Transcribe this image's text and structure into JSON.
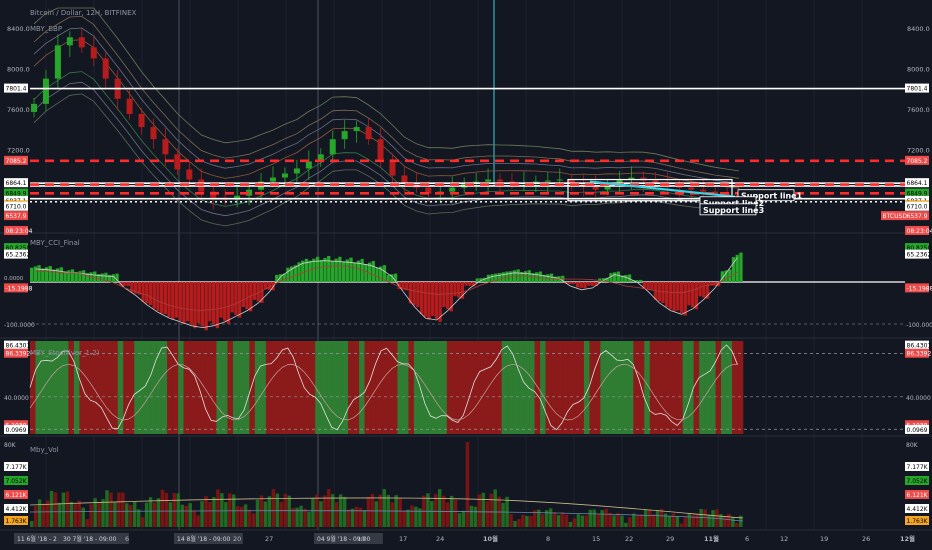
{
  "header": {
    "symbol_line": "Bitcoin / Dollar, 12H, BITFINEX",
    "indicator_label": "MBY_BBP"
  },
  "colors": {
    "background": "#131722",
    "bull": "#26a62a",
    "bear": "#b71c1c",
    "dash_red": "#ff2a2a",
    "cyan": "#3ad1e0",
    "white": "#ffffff"
  },
  "chart_data": [
    {
      "type": "line",
      "name": "price",
      "title": "Bitcoin / Dollar, 12H, BITFINEX",
      "y_ticks": [
        "8400.0",
        "8000.0",
        "7600.0",
        "7200.0"
      ],
      "ylim": [
        6400,
        8600
      ],
      "series_close_approx": [
        7650,
        7900,
        8230,
        8310,
        8210,
        8100,
        7900,
        7700,
        7550,
        7420,
        7300,
        7150,
        7000,
        6900,
        6780,
        6720,
        6700,
        6740,
        6800,
        6880,
        6920,
        6960,
        7010,
        7080,
        7150,
        7300,
        7380,
        7420,
        7300,
        7100,
        6940,
        6860,
        6820,
        6760,
        6780,
        6820,
        6860,
        6880,
        6900,
        6880,
        6860,
        6870,
        6880,
        6890,
        6900,
        6860,
        6830,
        6800,
        6840,
        6900,
        6920,
        6890,
        6860,
        6840,
        6820,
        6800,
        6780,
        6760,
        6745,
        6730
      ],
      "left_labels": [
        {
          "text": "7801.4",
          "kind": "white"
        },
        {
          "text": "7085.2",
          "kind": "red"
        },
        {
          "text": "6864.1",
          "kind": "white"
        },
        {
          "text": "6849.9",
          "kind": "green"
        },
        {
          "text": "6837.1",
          "kind": "white"
        },
        {
          "text": "6763.6",
          "kind": "orange"
        },
        {
          "text": "6710.0",
          "kind": "white"
        },
        {
          "text": "6537.9",
          "kind": "red"
        },
        {
          "text": "08:23:04",
          "kind": "red"
        }
      ],
      "right_labels": [
        {
          "text": "7801.4",
          "kind": "white"
        },
        {
          "text": "7085.2",
          "kind": "red"
        },
        {
          "text": "6864.1",
          "kind": "white"
        },
        {
          "text": "6849.9",
          "kind": "green"
        },
        {
          "text": "6837.1",
          "kind": "white"
        },
        {
          "text": "6763.6",
          "kind": "orange"
        },
        {
          "text": "6710.0",
          "kind": "white"
        },
        {
          "text": "6537.9",
          "kind": "red"
        },
        {
          "text": "BTCUSD",
          "kind": "red"
        },
        {
          "text": "08:23:04",
          "kind": "red"
        }
      ],
      "levels_solid": [
        7801.4,
        6864.1,
        6837.1,
        6710.0
      ],
      "levels_dashed_red": [
        7085.2,
        6849.9,
        6763.6
      ],
      "annotations": [
        "Support line1",
        "Support line2",
        "Support line3"
      ]
    },
    {
      "type": "bar",
      "name": "MBY_CCI_Final",
      "label": "MBY_CCI_Final",
      "left_ticks": [
        "80.8250",
        "65.2362",
        "-15.1988",
        "-100.0000"
      ],
      "right_ticks": [
        "80.8250",
        "65.2362",
        "-15.1988",
        "-100.0000"
      ],
      "zero_label": "0.0000",
      "values_approx": [
        40,
        38,
        35,
        30,
        28,
        25,
        22,
        20,
        -10,
        -30,
        -55,
        -75,
        -90,
        -100,
        -110,
        -115,
        -110,
        -100,
        -85,
        -70,
        -50,
        -20,
        20,
        40,
        55,
        60,
        62,
        60,
        58,
        55,
        50,
        40,
        20,
        -20,
        -60,
        -90,
        -95,
        -70,
        -40,
        -10,
        10,
        20,
        25,
        30,
        28,
        25,
        20,
        15,
        -5,
        -15,
        -10,
        10,
        25,
        18,
        5,
        -20,
        -50,
        -70,
        -80,
        -65,
        -40,
        -10,
        30,
        70
      ]
    },
    {
      "type": "line",
      "name": "MBY_Stoch",
      "label": "MBY_Stoch(ver_1.2)",
      "left_ticks": [
        "86.4301",
        "86.3392",
        "40.0000",
        "5.1030",
        "0.0969"
      ],
      "right_ticks": [
        "86.4301",
        "86.3392",
        "40.0000",
        "5.1030",
        "0.0969"
      ]
    },
    {
      "type": "bar",
      "name": "Mby_Vol",
      "label": "Mby_Vol",
      "left_ticks": [
        "80K",
        "7.177K",
        "7.052K",
        "6.121K",
        "4.412K",
        "1.763K"
      ],
      "right_ticks": [
        "80K",
        "7.177K",
        "7.052K",
        "6.121K",
        "4.412K",
        "1.763K"
      ]
    }
  ],
  "x_axis": {
    "labels": [
      "11 6월 '18 - 2",
      "30 7월 '18 - 09:00",
      "6",
      "14 8월 '18 - 09:00",
      "20",
      "27",
      "04 9월 '18 - 09:00",
      "10",
      "17",
      "24",
      "10월",
      "8",
      "15",
      "22",
      "29",
      "11월",
      "6",
      "12",
      "19",
      "26",
      "12월"
    ]
  }
}
